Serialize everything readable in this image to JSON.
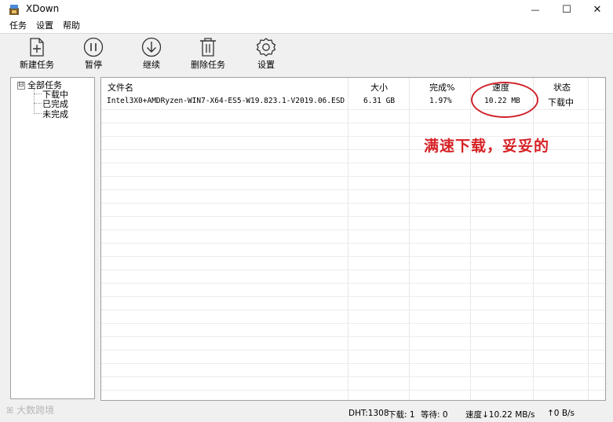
{
  "window": {
    "title": "XDown",
    "min_glyph": "—",
    "max_glyph": "☐",
    "close_glyph": "✕",
    "icon": "xdown-app-icon"
  },
  "menu": {
    "items": [
      "任务",
      "设置",
      "帮助"
    ]
  },
  "toolbar": {
    "new_task": "新建任务",
    "pause": "暂停",
    "resume": "继续",
    "delete_task": "删除任务",
    "settings": "设置"
  },
  "tree": {
    "root_toggle": "⊟",
    "root": "全部任务",
    "children": [
      "下载中",
      "已完成",
      "未完成"
    ]
  },
  "list": {
    "columns": [
      "文件名",
      "大小",
      "完成%",
      "速度",
      "状态"
    ],
    "rows": [
      {
        "filename": "Intel3X0+AMDRyzen-WIN7-X64-ES5-W19.823.1-V2019.06.ESD",
        "size": "6.31 GB",
        "progress": "1.97%",
        "speed": "10.22 MB",
        "status": "下载中"
      }
    ]
  },
  "annotation": {
    "text": "满速下载，妥妥的",
    "color": "#d62226"
  },
  "statusbar": {
    "dht": "DHT:1308",
    "downloading": "下载: 1",
    "waiting": "等待: 0",
    "download_speed": "速度↓10.22 MB/s",
    "upload_speed": "↑0 B/s"
  },
  "watermark": {
    "icon": "wechat-icon",
    "icon_glyph": "ꕤ",
    "text": "大数跨境"
  }
}
